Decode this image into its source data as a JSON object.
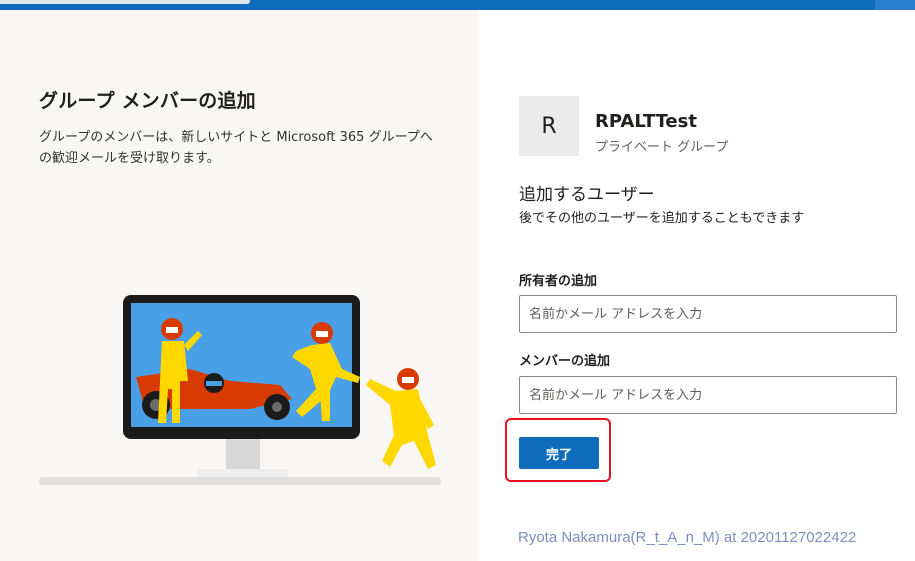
{
  "dialog": {
    "title": "グループ メンバーの追加",
    "description": "グループのメンバーは、新しいサイトと Microsoft 365 グループへの歓迎メールを受け取ります。"
  },
  "group": {
    "avatar_letter": "R",
    "name": "RPALTTest",
    "type": "プライベート グループ"
  },
  "section": {
    "title": "追加するユーザー",
    "subtitle": "後でその他のユーザーを追加することもできます"
  },
  "owners": {
    "label": "所有者の追加",
    "placeholder": "名前かメール アドレスを入力",
    "value": ""
  },
  "members": {
    "label": "メンバーの追加",
    "placeholder": "名前かメール アドレスを入力",
    "value": ""
  },
  "actions": {
    "done_label": "完了"
  },
  "watermark": "Ryota Nakamura(R_t_A_n_M) at 20201127022422",
  "colors": {
    "accent": "#0f6cbd",
    "highlight": "#e81123",
    "left_pane_bg": "#f8f7f6"
  },
  "icons": {
    "illustration": "team-racing-illustration"
  }
}
